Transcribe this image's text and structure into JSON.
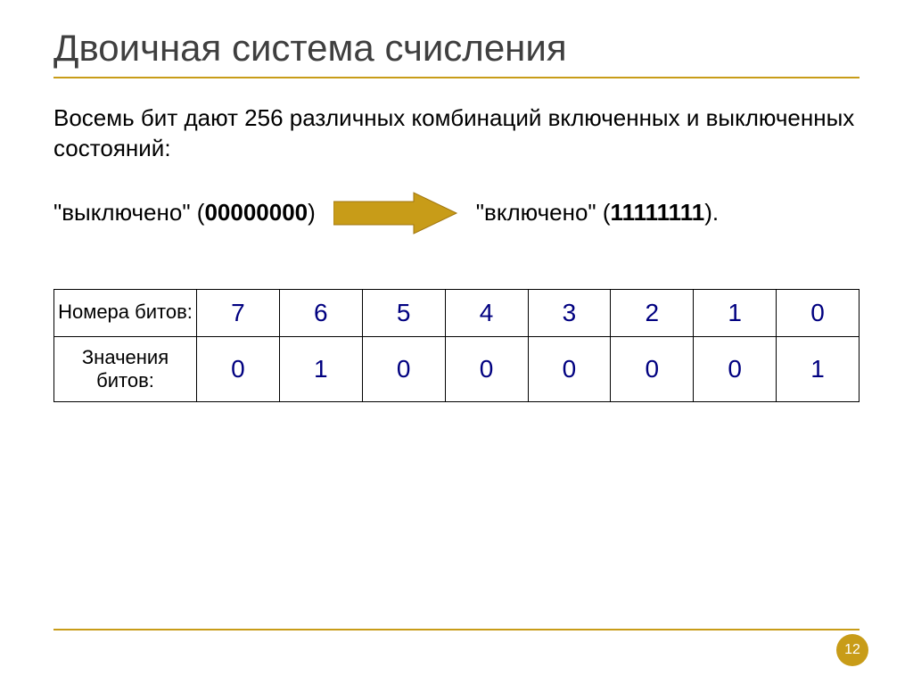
{
  "title": "Двоичная система счисления",
  "paragraph": "Восемь бит дают 256 различных комбинаций включенных и выключенных состояний:",
  "state_off_prefix": "\"выключено\" (",
  "state_off_bits": "00000000",
  "state_off_suffix": ")",
  "state_on_prefix": "\"включено\" (",
  "state_on_bits": "11111111",
  "state_on_suffix": ").",
  "table": {
    "row1_header": "Номера битов:",
    "row2_header": "Значения битов:"
  },
  "chart_data": {
    "type": "table",
    "row1_label": "Номера битов:",
    "row1": [
      "7",
      "6",
      "5",
      "4",
      "3",
      "2",
      "1",
      "0"
    ],
    "row2_label": "Значения битов:",
    "row2": [
      "0",
      "1",
      "0",
      "0",
      "0",
      "0",
      "0",
      "1"
    ]
  },
  "page_number": "12",
  "arrow_fill": "#c89c18",
  "arrow_stroke": "#a07610"
}
